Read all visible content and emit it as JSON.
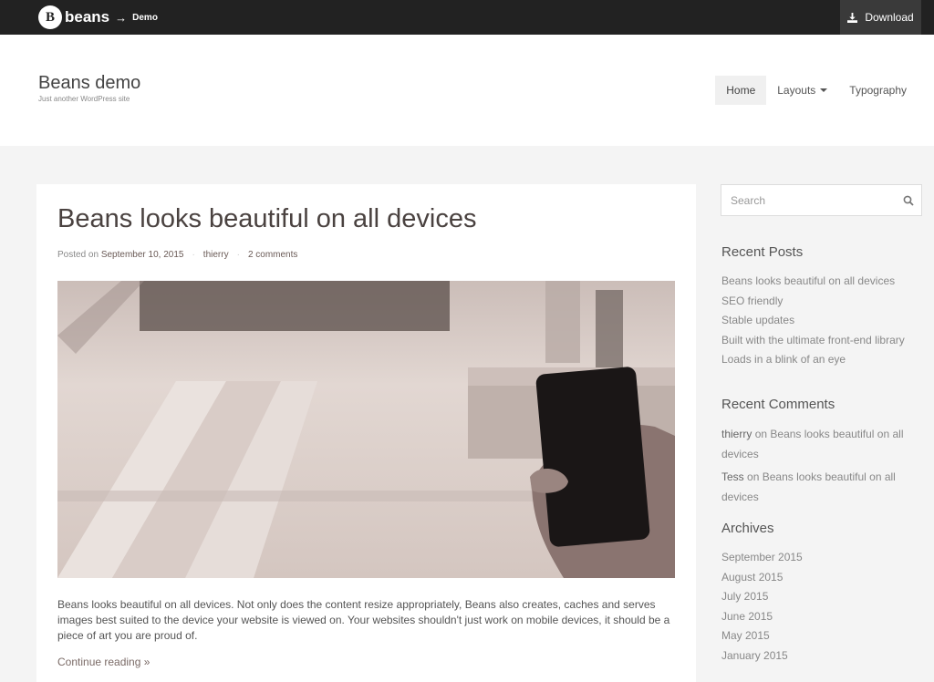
{
  "topbar": {
    "logo_letter": "B",
    "brand": "beans",
    "arrow": "→",
    "demo": "Demo",
    "download_label": "Download"
  },
  "site": {
    "title": "Beans demo",
    "description": "Just another WordPress site"
  },
  "nav": {
    "items": [
      {
        "label": "Home"
      },
      {
        "label": "Layouts"
      },
      {
        "label": "Typography"
      }
    ]
  },
  "post": {
    "title": "Beans looks beautiful on all devices",
    "posted_on_prefix": "Posted on",
    "date": "September 10, 2015",
    "author": "thierry",
    "comments": "2 comments",
    "excerpt": "Beans looks beautiful on all devices. Not only does the content resize appropriately, Beans also creates, caches and serves images best suited to the device your website is viewed on. Your websites shouldn't just work on mobile devices, it should be a piece of art you are proud of.",
    "continue_reading": "Continue reading »"
  },
  "sidebar": {
    "search_placeholder": "Search",
    "recent_posts": {
      "title": "Recent Posts",
      "items": [
        "Beans looks beautiful on all devices",
        "SEO friendly",
        "Stable updates",
        "Built with the ultimate front-end library",
        "Loads in a blink of an eye"
      ]
    },
    "recent_comments": {
      "title": "Recent Comments",
      "on_word": "on",
      "items": [
        {
          "author": "thierry",
          "post": "Beans looks beautiful on all devices"
        },
        {
          "author": "Tess",
          "post": "Beans looks beautiful on all devices"
        }
      ]
    },
    "archives": {
      "title": "Archives",
      "items": [
        "September 2015",
        "August 2015",
        "July 2015",
        "June 2015",
        "May 2015",
        "January 2015"
      ]
    }
  },
  "colors": {
    "topbar_bg": "#222222",
    "download_bg": "#3a3a3a",
    "title_color": "#4a4240",
    "link_color": "#7a6a66"
  },
  "icons": {
    "download": "download-icon",
    "search": "search-icon",
    "caret": "chevron-down-icon",
    "logo": "beans-logo-icon"
  }
}
